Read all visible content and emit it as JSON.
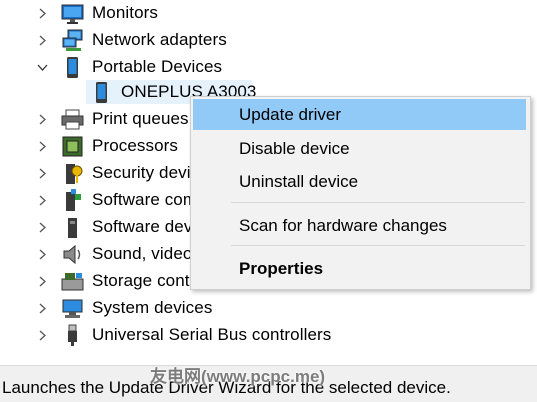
{
  "tree": {
    "items": [
      {
        "label": "Monitors",
        "icon": "monitor-icon",
        "state": "collapsed"
      },
      {
        "label": "Network adapters",
        "icon": "network-adapter-icon",
        "state": "collapsed"
      },
      {
        "label": "Portable Devices",
        "icon": "portable-device-icon",
        "state": "expanded"
      },
      {
        "label": "ONEPLUS A3003",
        "icon": "phone-icon",
        "state": "leaf-selected"
      },
      {
        "label": "Print queues",
        "icon": "printer-icon",
        "state": "collapsed"
      },
      {
        "label": "Processors",
        "icon": "processor-icon",
        "state": "collapsed"
      },
      {
        "label": "Security devices",
        "icon": "security-device-icon",
        "state": "collapsed"
      },
      {
        "label": "Software components",
        "icon": "software-component-icon",
        "state": "collapsed"
      },
      {
        "label": "Software devices",
        "icon": "software-device-icon",
        "state": "collapsed"
      },
      {
        "label": "Sound, video and game controllers",
        "icon": "speaker-icon",
        "state": "collapsed"
      },
      {
        "label": "Storage controllers",
        "icon": "storage-controller-icon",
        "state": "collapsed"
      },
      {
        "label": "System devices",
        "icon": "system-device-icon",
        "state": "collapsed"
      },
      {
        "label": "Universal Serial Bus controllers",
        "icon": "usb-icon",
        "state": "collapsed"
      }
    ]
  },
  "context_menu": {
    "items": [
      {
        "label": "Update driver",
        "hovered": true
      },
      {
        "label": "Disable device"
      },
      {
        "label": "Uninstall device"
      },
      {
        "label": "Scan for hardware changes"
      },
      {
        "label": "Properties",
        "bold": true
      }
    ]
  },
  "status_bar": {
    "text": "Launches the Update Driver Wizard for the selected device."
  },
  "watermark": "友电网(www.pcpc.me)",
  "colors": {
    "menu_hover": "#91c9f7",
    "selection": "#e5f1fb",
    "menu_bg": "#f2f2f2"
  }
}
